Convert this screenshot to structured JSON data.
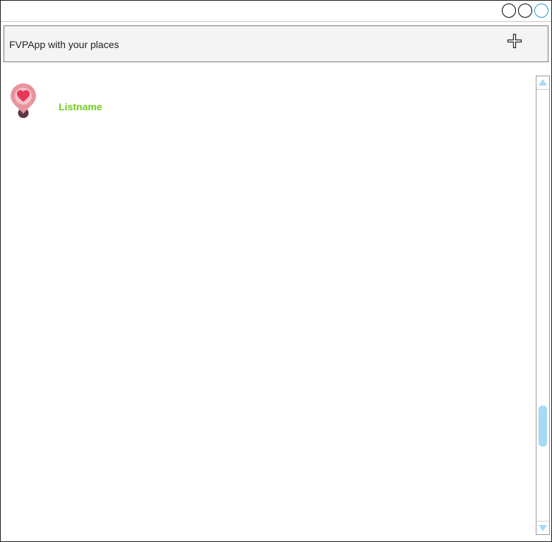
{
  "window": {
    "controls": [
      "circle-button",
      "circle-button",
      "circle-button-active"
    ],
    "active_color": "#1e9ad6"
  },
  "header": {
    "title": "FVPApp with your places",
    "add_icon": "plus-icon"
  },
  "list": {
    "items": [
      {
        "icon": "heart-pin-icon",
        "label": "Listname",
        "label_color": "#6fcc1d"
      }
    ]
  },
  "scrollbar": {
    "position": 0.81,
    "up_icon": "triangle-up-icon",
    "down_icon": "triangle-down-icon",
    "color": "#a6dbf5"
  },
  "colors": {
    "pin_outer": "#e8939d",
    "pin_inner": "#f5c1c8",
    "heart": "#e8375b",
    "pin_base": "#5a3944"
  }
}
